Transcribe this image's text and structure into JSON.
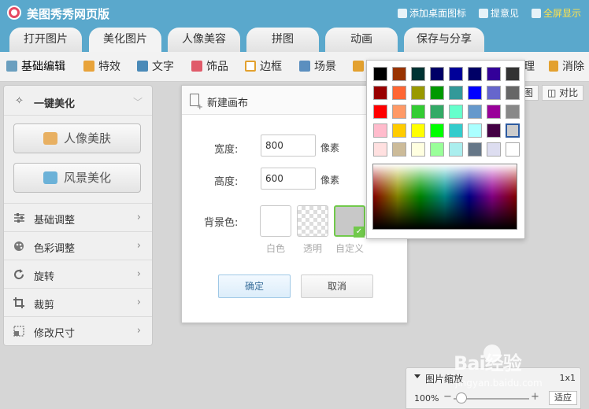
{
  "app": {
    "title": "美图秀秀网页版"
  },
  "title_links": [
    {
      "label": "添加桌面图标",
      "icon": "star-icon"
    },
    {
      "label": "提意见",
      "icon": "chat-icon"
    },
    {
      "label": "全屏显示",
      "icon": "fullscreen-icon"
    }
  ],
  "main_tabs": [
    {
      "label": "打开图片"
    },
    {
      "label": "美化图片",
      "active": true
    },
    {
      "label": "人像美容"
    },
    {
      "label": "拼图"
    },
    {
      "label": "动画"
    },
    {
      "label": "保存与分享"
    }
  ],
  "toolbar": [
    {
      "label": "基础编辑",
      "icon": "grid-icon",
      "active": true
    },
    {
      "label": "特效",
      "icon": "brush-icon"
    },
    {
      "label": "文字",
      "icon": "text-icon"
    },
    {
      "label": "饰品",
      "icon": "bow-icon"
    },
    {
      "label": "边框",
      "icon": "frame-icon"
    },
    {
      "label": "场景",
      "icon": "scene-icon"
    },
    {
      "label": "理",
      "icon": "pen-icon"
    },
    {
      "label": "消除",
      "icon": "eraser-icon"
    }
  ],
  "left_panel": {
    "header": "一键美化",
    "buttons": [
      {
        "label": "人像美肤",
        "icon": "face-icon"
      },
      {
        "label": "风景美化",
        "icon": "landscape-icon"
      }
    ],
    "items": [
      {
        "label": "基础调整",
        "icon": "sliders-icon"
      },
      {
        "label": "色彩调整",
        "icon": "palette-icon"
      },
      {
        "label": "旋转",
        "icon": "rotate-icon"
      },
      {
        "label": "裁剪",
        "icon": "crop-icon"
      },
      {
        "label": "修改尺寸",
        "icon": "resize-icon"
      }
    ]
  },
  "right_buttons": [
    {
      "label": "图"
    },
    {
      "label": "对比"
    }
  ],
  "dialog": {
    "title": "新建画布",
    "width_label": "宽度:",
    "width_value": "800",
    "height_label": "高度:",
    "height_value": "600",
    "unit": "像素",
    "bg_label": "背景色:",
    "bg_options": [
      "白色",
      "透明",
      "自定义"
    ],
    "selected_bg": "自定义",
    "ok_label": "确定",
    "cancel_label": "取消"
  },
  "color_picker": {
    "rows": [
      [
        "#000000",
        "#993300",
        "#003333",
        "#000066",
        "#000099",
        "#000066",
        "#330099",
        "#333333"
      ],
      [
        "#990000",
        "#ff6633",
        "#999900",
        "#009900",
        "#339999",
        "#0000ff",
        "#6666cc",
        "#666666"
      ],
      [
        "#ff0000",
        "#ff9966",
        "#33cc33",
        "#33aa66",
        "#66ffcc",
        "#6699cc",
        "#990099",
        "#888888"
      ],
      [
        "#ffbbcc",
        "#ffcc00",
        "#ffff00",
        "#00ff00",
        "#33cccc",
        "#aaffff",
        "#440044",
        "#cccccc"
      ],
      [
        "#ffe0e0",
        "#ccbb99",
        "#ffffe0",
        "#99ff99",
        "#aaeeee",
        "#667788",
        "#ddddf0",
        "#ffffff"
      ]
    ],
    "selected": "#cccccc"
  },
  "zoom": {
    "title": "图片缩放",
    "one_to_one": "1x1",
    "percent": "100%",
    "fit_label": "适应",
    "level": 0.05
  },
  "watermark": {
    "brand": "Bai经验",
    "url": "jingyan.baidu.com"
  }
}
